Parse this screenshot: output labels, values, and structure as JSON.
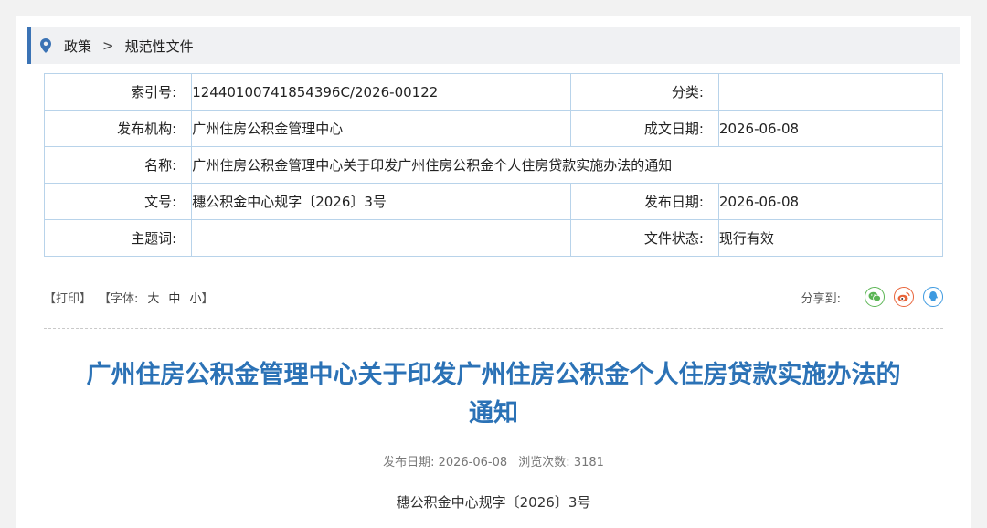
{
  "breadcrumb": {
    "icon": "location-pin-icon",
    "items": [
      "政策",
      "规范性文件"
    ],
    "separator": ">"
  },
  "info": {
    "index_no_label": "索引号:",
    "index_no": "12440100741854396C/2026-00122",
    "category_label": "分类:",
    "category": "",
    "publisher_label": "发布机构:",
    "publisher": "广州住房公积金管理中心",
    "written_date_label": "成文日期:",
    "written_date": "2026-06-08",
    "name_label": "名称:",
    "name": "广州住房公积金管理中心关于印发广州住房公积金个人住房贷款实施办法的通知",
    "doc_no_label": "文号:",
    "doc_no": "穗公积金中心规字〔2026〕3号",
    "publish_date_label": "发布日期:",
    "publish_date": "2026-06-08",
    "keywords_label": "主题词:",
    "keywords": "",
    "status_label": "文件状态:",
    "status": "现行有效"
  },
  "toolbar": {
    "print": "【打印】",
    "font_prefix": "【字体:",
    "font_large": "大",
    "font_medium": "中",
    "font_small": "小",
    "font_suffix": "】",
    "share_label": "分享到:"
  },
  "colors": {
    "accent": "#2b72b6",
    "table_border": "#b8d3ea",
    "wechat": "#5bb554",
    "weibo": "#e8643a",
    "qq": "#3e9ae0"
  },
  "article": {
    "title_line1": "广州住房公积金管理中心关于印发广州住房公积金个人住房贷款实施办法的",
    "title_line2": "通知",
    "meta_date_label": "发布日期:",
    "meta_date": "2026-06-08",
    "meta_views_label": "浏览次数:",
    "meta_views": "3181",
    "doc_no": "穗公积金中心规字〔2026〕3号"
  }
}
